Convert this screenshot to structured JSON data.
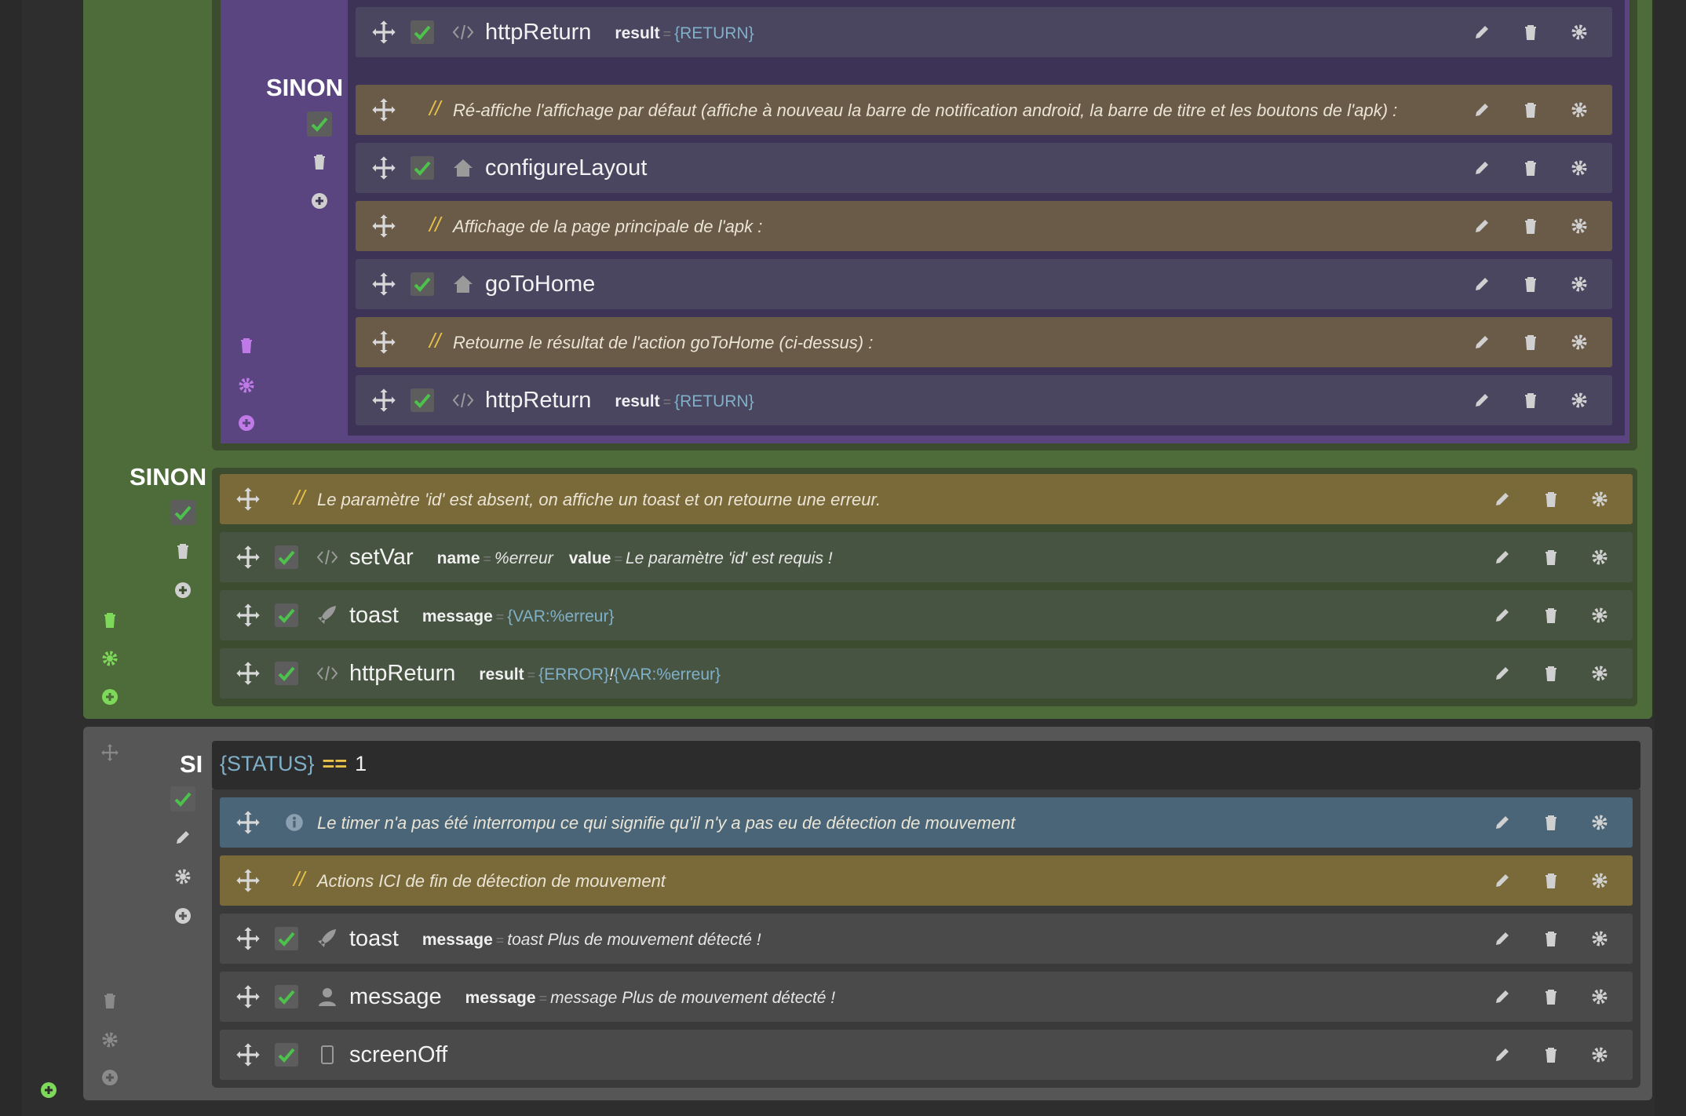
{
  "blocks": {
    "sinon_inner": {
      "label": "SINON"
    },
    "sinon_outer": {
      "label": "SINON"
    },
    "si": {
      "label": "SI",
      "condition_var": "{STATUS}",
      "condition_op": "==",
      "condition_value": "1"
    }
  },
  "rows": [
    {
      "kind": "code-icon",
      "title": "httpReturn",
      "params": [
        {
          "name": "result",
          "value": "{RETURN}",
          "style": "var"
        }
      ]
    },
    {
      "comment": "Ré-affiche l'affichage par défaut (affiche à nouveau la barre de notification android, la barre de titre et les boutons de l'apk) :"
    },
    {
      "kind": "home-icon",
      "title": "configureLayout"
    },
    {
      "comment": "Affichage de la page principale de l'apk :"
    },
    {
      "kind": "home-icon",
      "title": "goToHome"
    },
    {
      "comment": "Retourne le résultat de l'action goToHome (ci-dessus) :"
    },
    {
      "kind": "code-icon",
      "title": "httpReturn",
      "params": [
        {
          "name": "result",
          "value": "{RETURN}",
          "style": "var"
        }
      ]
    },
    {
      "comment": "Le paramètre 'id' est absent, on affiche un toast et on retourne une erreur."
    },
    {
      "kind": "code-icon",
      "title": "setVar",
      "params": [
        {
          "name": "name",
          "value": "%erreur",
          "style": "txt"
        },
        {
          "name": "value",
          "value": "Le paramètre 'id' est requis !",
          "style": "txt"
        }
      ]
    },
    {
      "kind": "rocket-icon",
      "title": "toast",
      "params": [
        {
          "name": "message",
          "value": "{VAR:%erreur}",
          "style": "var"
        }
      ]
    },
    {
      "kind": "code-icon",
      "title": "httpReturn",
      "params": [
        {
          "name": "result",
          "value": "{ERROR}",
          "style": "var"
        },
        {
          "name": "",
          "value": "!",
          "style": "txt"
        },
        {
          "name": "",
          "value": "{VAR:%erreur}",
          "style": "var"
        }
      ]
    },
    {
      "info": "Le timer n'a pas été interrompu ce qui signifie qu'il n'y a pas eu de détection de mouvement"
    },
    {
      "comment": "Actions ICI de fin de détection de mouvement"
    },
    {
      "kind": "rocket-icon",
      "title": "toast",
      "params": [
        {
          "name": "message",
          "value": "toast Plus de mouvement détecté !",
          "style": "txt"
        }
      ]
    },
    {
      "kind": "user-icon",
      "title": "message",
      "params": [
        {
          "name": "message",
          "value": "message Plus de mouvement détecté !",
          "style": "txt"
        }
      ]
    },
    {
      "kind": "tablet-icon",
      "title": "screenOff"
    }
  ],
  "colors": {
    "comment_slashes": "#e8c14a",
    "var_value": "#7fb0c8",
    "check": "#4cc24c",
    "purple_icons": "#c07ae8",
    "green_icons": "#7ed85a"
  }
}
